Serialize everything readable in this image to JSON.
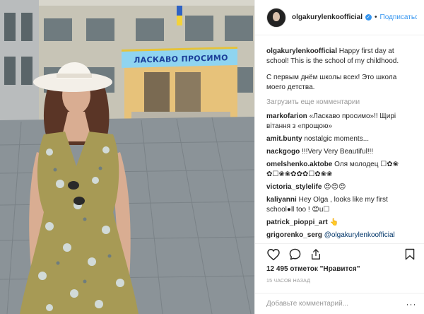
{
  "photo": {
    "banner_text": "ЛАСКАВО ПРОСИМО"
  },
  "header": {
    "username": "olgakurylenkoofficial",
    "verified_icon": "verified-badge-icon",
    "separator": "•",
    "follow_label": "Подписаться"
  },
  "caption": {
    "username": "olgakurylenkoofficial",
    "text_en": " Happy first day at school! This is the school of my childhood.",
    "text_ru": "С первым днём школы всех! Это школа моего детства."
  },
  "load_more_label": "Загрузить еще комментарии",
  "comments": [
    {
      "user": "markofarion",
      "text": " «Ласкаво просимо»!! Щирі вітання з «прощою»"
    },
    {
      "user": "amit.bunty",
      "text": " nostalgic moments..."
    },
    {
      "user": "nackgogo",
      "text": " !!!Very Very Beautiful!!!"
    },
    {
      "user": "omelshenko.aktobe",
      "text": " Оля молодец ☐✿❀ ✿☐❀❀✿✿✿☐✿❀❀"
    },
    {
      "user": "victoria_stylelife",
      "text": " 😍😍😍"
    },
    {
      "user": "kaliyanni",
      "text": " Hey Olga , looks like my first school●ll too ! 😊u☐"
    },
    {
      "user": "patrick_pioppi_art",
      "text": " 👆"
    },
    {
      "user": "grigorenko_serg",
      "text": " ",
      "mention": "@olgakurylenkoofficial"
    }
  ],
  "actions": {
    "like_icon": "heart-icon",
    "comment_icon": "comment-bubble-icon",
    "share_icon": "share-icon",
    "save_icon": "bookmark-icon"
  },
  "likes_label": "12 495 отметок \"Нравится\"",
  "timestamp": "15 часов назад",
  "comment_placeholder": "Добавьте комментарий...",
  "more_label": "···"
}
